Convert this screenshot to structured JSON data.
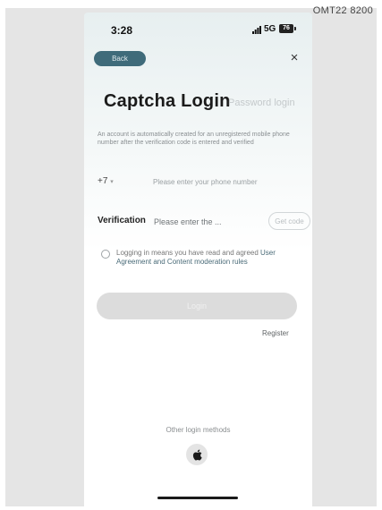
{
  "corner_code": "OMT22 8200",
  "status_bar": {
    "time": "3:28",
    "network": "5G",
    "battery": "76"
  },
  "header": {
    "back_label": "Back",
    "close_label": "×"
  },
  "login": {
    "title": "Captcha Login",
    "alt_tab": "Password login",
    "notice": "An account is automatically created for an unregistered mobile phone number after the verification code is entered and verified",
    "country_code": "+7",
    "phone_placeholder": "Please enter your phone number",
    "verification_label": "Verification",
    "verification_placeholder": "Please enter the ...",
    "get_code_label": "Get code",
    "agreement_prefix": "Logging in means you have read and agreed ",
    "agreement_links": "User Agreement and Content moderation rules",
    "login_button": "Login",
    "register_link": "Register"
  },
  "footer": {
    "other_methods": "Other login methods"
  },
  "icons": {
    "apple": "apple-icon",
    "signal": "signal-icon",
    "battery": "battery-icon",
    "close": "close-icon",
    "caret": "chevron-down-icon"
  },
  "colors": {
    "back_button": "#3f6b7a",
    "login_button_disabled": "#dcdcdc",
    "link": "#4a6b78"
  }
}
